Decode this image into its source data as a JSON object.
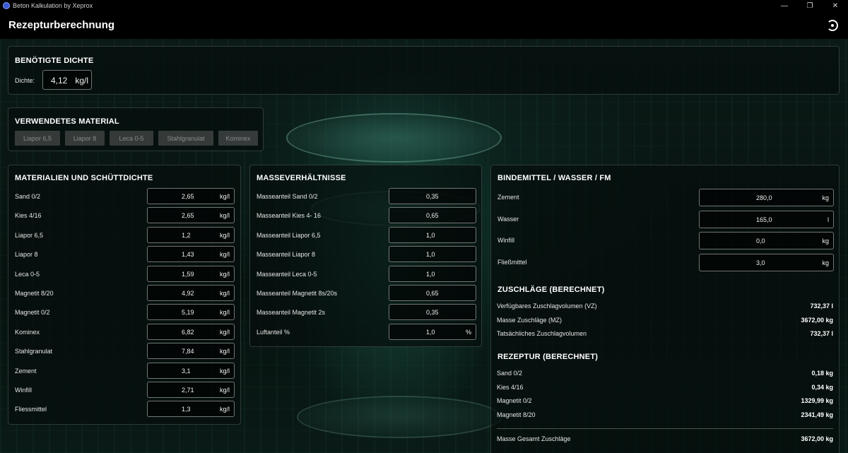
{
  "window": {
    "title": "Beton Kalkulation by Xeprox",
    "controls": {
      "minimize": "—",
      "maximize": "❐",
      "close": "✕"
    }
  },
  "header": {
    "title": "Rezepturberechnung"
  },
  "density": {
    "title": "BENÖTIGTE DICHTE",
    "label": "Dichte:",
    "value": "4,12",
    "unit": "kg/l"
  },
  "material": {
    "title": "VERWENDETES MATERIAL",
    "chips": [
      "Liapor 6,5",
      "Liapor 8",
      "Leca 0-5",
      "Stahlgranulat",
      "Kominex"
    ]
  },
  "bulk_density": {
    "title": "MATERIALIEN UND SCHÜTTDICHTE",
    "rows": [
      {
        "label": "Sand 0/2",
        "value": "2,65",
        "unit": "kg/l"
      },
      {
        "label": "Kies 4/16",
        "value": "2,65",
        "unit": "kg/l"
      },
      {
        "label": "Liapor 6,5",
        "value": "1,2",
        "unit": "kg/l"
      },
      {
        "label": "Liapor 8",
        "value": "1,43",
        "unit": "kg/l"
      },
      {
        "label": "Leca 0-5",
        "value": "1,59",
        "unit": "kg/l"
      },
      {
        "label": "Magnetit 8/20",
        "value": "4,92",
        "unit": "kg/l"
      },
      {
        "label": "Magnetit 0/2",
        "value": "5,19",
        "unit": "kg/l"
      },
      {
        "label": "Kominex",
        "value": "6,82",
        "unit": "kg/l"
      },
      {
        "label": "Stahlgranulat",
        "value": "7,84",
        "unit": "kg/l"
      },
      {
        "label": "Zement",
        "value": "3,1",
        "unit": "kg/l"
      },
      {
        "label": "Winfill",
        "value": "2,71",
        "unit": "kg/l"
      },
      {
        "label": "Fliessmittel",
        "value": "1,3",
        "unit": "kg/l"
      }
    ]
  },
  "mass_ratios": {
    "title": "MASSEVERHÄLTNISSE",
    "rows": [
      {
        "label": "Masseanteil Sand 0/2",
        "value": "0,35",
        "unit": ""
      },
      {
        "label": "Masseanteil Kies 4- 16",
        "value": "0,65",
        "unit": ""
      },
      {
        "label": "Masseanteil Liapor 6,5",
        "value": "1,0",
        "unit": ""
      },
      {
        "label": "Masseanteil Liapor 8",
        "value": "1,0",
        "unit": ""
      },
      {
        "label": "Masseanteil Leca 0-5",
        "value": "1,0",
        "unit": ""
      },
      {
        "label": "Masseanteil Magnetit 8s/20s",
        "value": "0,65",
        "unit": ""
      },
      {
        "label": "Masseanteil Magnetit 2s",
        "value": "0,35",
        "unit": ""
      },
      {
        "label": "Luftanteil %",
        "value": "1,0",
        "unit": "%"
      }
    ]
  },
  "binder": {
    "title": "BINDEMITTEL / WASSER / FM",
    "rows": [
      {
        "label": "Zement",
        "value": "280,0",
        "unit": "kg"
      },
      {
        "label": "Wasser",
        "value": "165,0",
        "unit": "l"
      },
      {
        "label": "Winfill",
        "value": "0,0",
        "unit": "kg"
      },
      {
        "label": "Fließmittel",
        "value": "3,0",
        "unit": "kg"
      }
    ]
  },
  "aggregates": {
    "title": "ZUSCHLÄGE (BERECHNET)",
    "rows": [
      {
        "label": "Verfügbares Zuschlagvolumen (VZ)",
        "value": "732,37 l"
      },
      {
        "label": "Masse Zuschläge (MZ)",
        "value": "3672,00 kg"
      },
      {
        "label": "Tatsächliches Zuschlagvolumen",
        "value": "732,37 l"
      }
    ]
  },
  "recipe": {
    "title": "REZEPTUR (BERECHNET)",
    "rows": [
      {
        "label": "Sand 0/2",
        "value": "0,18 kg"
      },
      {
        "label": "Kies 4/16",
        "value": "0,34 kg"
      },
      {
        "label": "Magnetit 0/2",
        "value": "1329,99 kg"
      },
      {
        "label": "Magnetit 8/20",
        "value": "2341,49 kg"
      }
    ],
    "total": {
      "label": "Masse Gesamt Zuschläge",
      "value": "3672,00 kg"
    }
  }
}
